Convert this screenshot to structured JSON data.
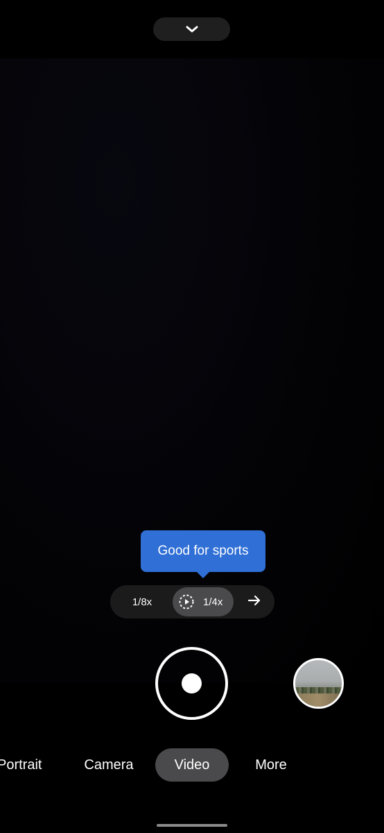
{
  "viewfinder": {
    "label": ""
  },
  "top": {
    "collapse_icon": "chevron-down-icon"
  },
  "tooltip": {
    "text": "Good for sports"
  },
  "speed": {
    "options": [
      "1/8x",
      "1/4x"
    ],
    "selected": "1/4x",
    "slowmo_icon": "slow-motion-icon",
    "next_icon": "arrow-right-icon"
  },
  "controls": {
    "shutter_icon": "record-button",
    "thumbnail_icon": "gallery-thumbnail"
  },
  "modes": {
    "items": [
      "Portrait",
      "Camera",
      "Video",
      "More"
    ],
    "active": "Video"
  },
  "colors": {
    "tooltip": "#2f6fd6",
    "pill_bg": "#1f1f1f",
    "active_bg": "#4a4a4c"
  }
}
